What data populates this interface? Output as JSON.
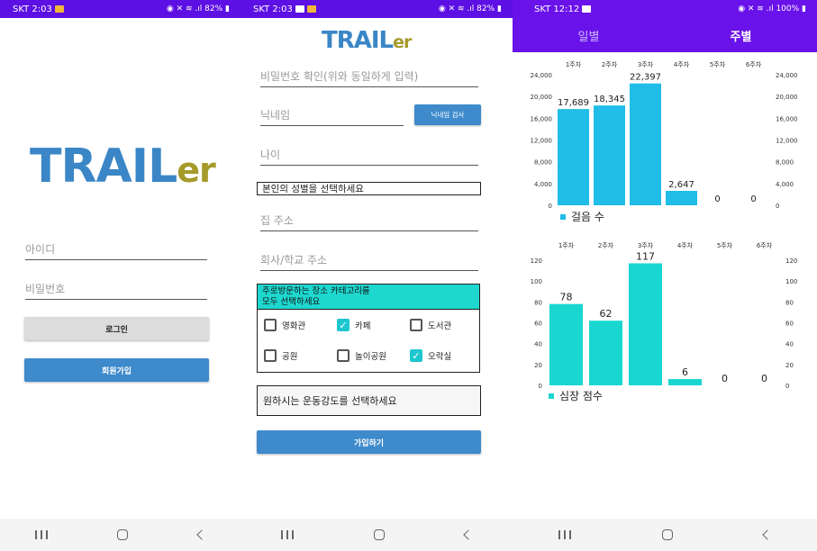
{
  "colors": {
    "brand_blue": "#3a86c6",
    "brand_gold": "#a59a2a",
    "purple": "#6a12ea",
    "steps_color": "#1fbde8",
    "heart_color": "#1ad6d0",
    "teal_header": "#1ed7cf"
  },
  "screen1": {
    "status": {
      "left": "SKT 2:03",
      "right": "82%"
    },
    "logo": {
      "main": "TRAIL",
      "suffix": "er"
    },
    "id_placeholder": "아이디",
    "password_placeholder": "비밀번호",
    "login_button": "로그인",
    "signup_button": "회원가입"
  },
  "screen2": {
    "status": {
      "left": "SKT 2:03",
      "right": "82%"
    },
    "logo": {
      "main": "TRAIL",
      "suffix": "er"
    },
    "password_confirm_placeholder": "비밀번호 확인(위와 동일하게 입력)",
    "nickname_placeholder": "닉네임",
    "nickname_check_button": "닉네임 검사",
    "age_placeholder": "나이",
    "gender_select": "본인의 성별을 선택하세요",
    "home_address_placeholder": "집 주소",
    "work_address_placeholder": "회사/학교 주소",
    "category_header_line1": "주로방문하는 장소 카테고리를",
    "category_header_line2": "모두 선택하세요",
    "categories": [
      {
        "label": "영화관",
        "checked": false
      },
      {
        "label": "카페",
        "checked": true
      },
      {
        "label": "도서관",
        "checked": false
      },
      {
        "label": "공원",
        "checked": false
      },
      {
        "label": "놀이공원",
        "checked": false
      },
      {
        "label": "오락실",
        "checked": true
      }
    ],
    "intensity_select": "원하시는 운동강도를 선택하세요",
    "join_button": "가입하기"
  },
  "screen3": {
    "status": {
      "left": "SKT 12:12",
      "right": "100%"
    },
    "tabs": [
      {
        "label": "일별",
        "active": false
      },
      {
        "label": "주별",
        "active": true
      }
    ]
  },
  "chart_data": [
    {
      "type": "bar",
      "categories": [
        "1주차",
        "2주차",
        "3주차",
        "4주차",
        "5주차",
        "6주차"
      ],
      "series": [
        {
          "name": "걸음 수",
          "values": [
            17689,
            18345,
            22397,
            2647,
            0,
            0
          ]
        }
      ],
      "value_labels": [
        "17,689",
        "18,345",
        "22,397",
        "2,647",
        "0",
        "0"
      ],
      "ylim": [
        0,
        24000
      ],
      "yticks": [
        "0",
        "4,000",
        "8,000",
        "12,000",
        "16,000",
        "20,000",
        "24,000"
      ],
      "legend": "bottom-left",
      "color": "#1fbde8"
    },
    {
      "type": "bar",
      "categories": [
        "1주차",
        "2주차",
        "3주차",
        "4주차",
        "5주차",
        "6주차"
      ],
      "series": [
        {
          "name": "심장 점수",
          "values": [
            78,
            62,
            117,
            6,
            0,
            0
          ]
        }
      ],
      "value_labels": [
        "78",
        "62",
        "117",
        "6",
        "0",
        "0"
      ],
      "ylim": [
        0,
        120
      ],
      "yticks": [
        "0",
        "20",
        "40",
        "60",
        "80",
        "100",
        "120"
      ],
      "legend": "bottom-left",
      "color": "#1ad6d0"
    }
  ],
  "navbar_icons": [
    "recent-apps-icon",
    "home-icon",
    "back-icon"
  ]
}
